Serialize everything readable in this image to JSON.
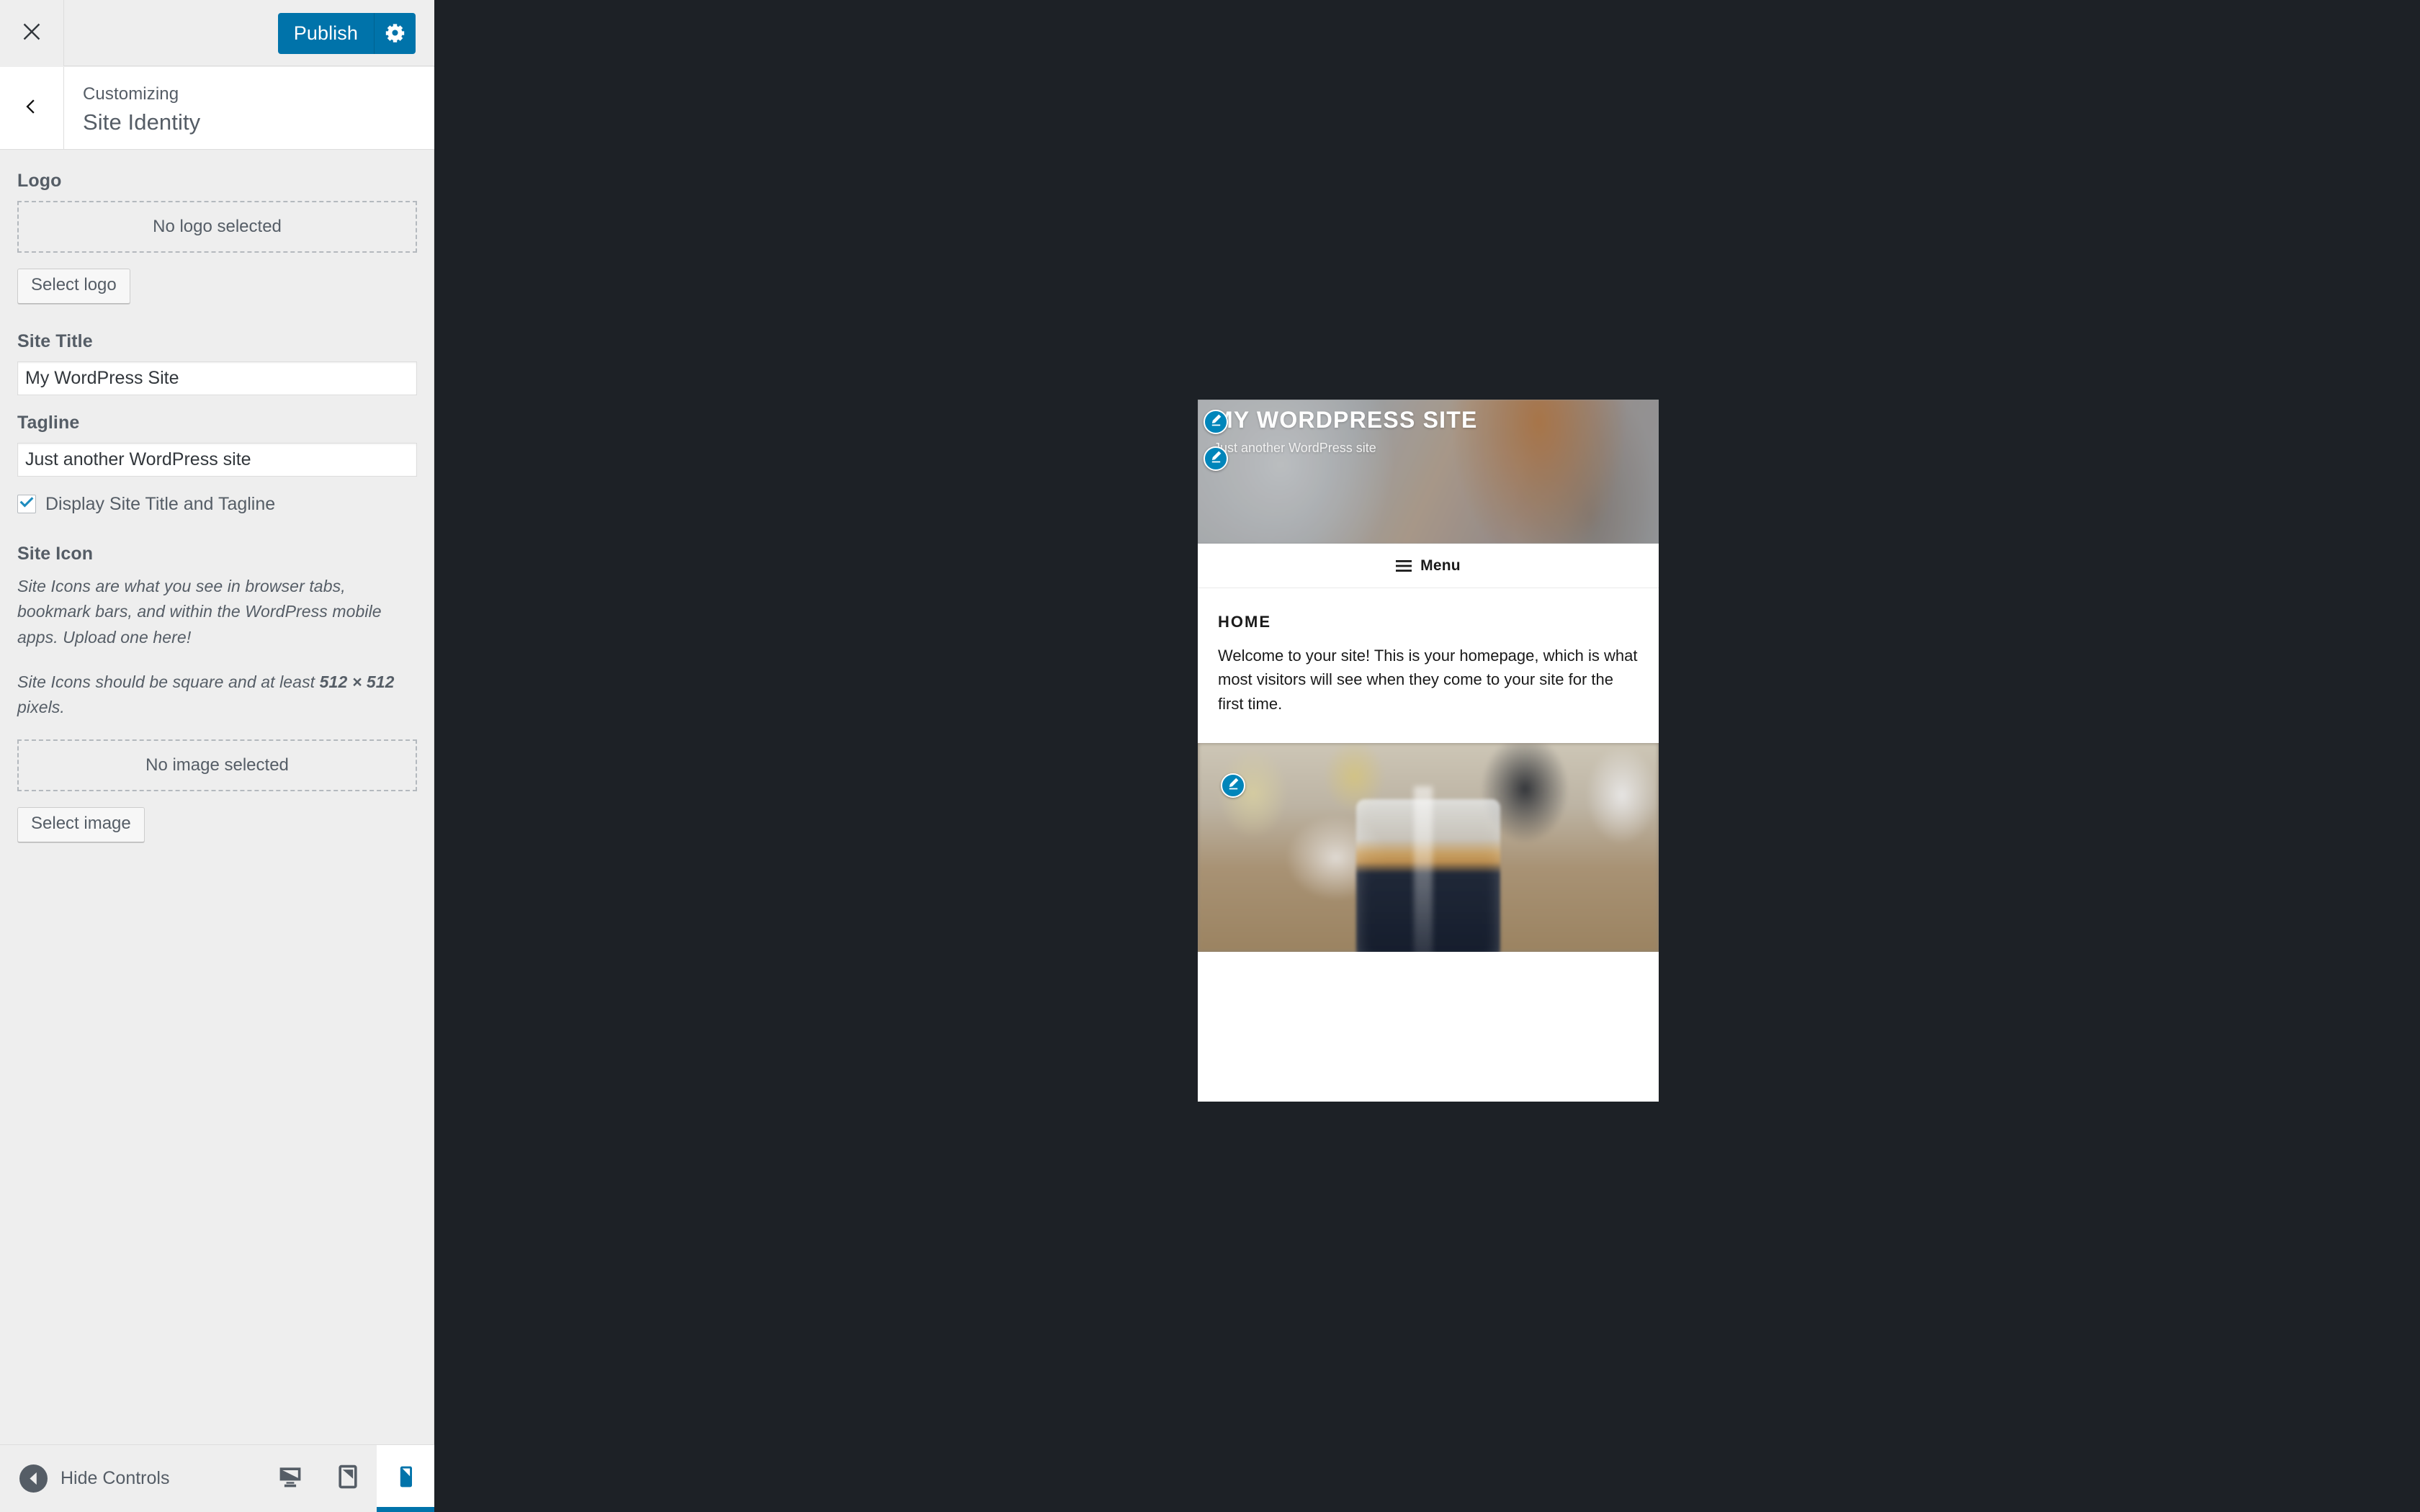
{
  "sidebar": {
    "header": {
      "close_icon": "close-icon",
      "publish_label": "Publish",
      "gear_icon": "gear-icon"
    },
    "panel": {
      "back_icon": "chevron-left-icon",
      "eyebrow": "Customizing",
      "title": "Site Identity"
    },
    "controls": {
      "logo": {
        "label": "Logo",
        "placeholder": "No logo selected",
        "button": "Select logo"
      },
      "site_title": {
        "label": "Site Title",
        "value": "My WordPress Site"
      },
      "tagline": {
        "label": "Tagline",
        "value": "Just another WordPress site"
      },
      "display_toggle": {
        "label": "Display Site Title and Tagline",
        "checked": true,
        "check_icon": "check-icon"
      },
      "site_icon": {
        "label": "Site Icon",
        "help_1": "Site Icons are what you see in browser tabs, bookmark bars, and within the WordPress mobile apps. Upload one here!",
        "help_2_before": "Site Icons should be square and at least ",
        "help_2_strong": "512 × 512",
        "help_2_after": " pixels.",
        "placeholder": "No image selected",
        "button": "Select image"
      }
    },
    "footer": {
      "collapse_icon": "collapse-arrow-icon",
      "collapse_label": "Hide Controls",
      "devices": [
        {
          "name": "desktop",
          "icon": "desktop-icon",
          "active": false
        },
        {
          "name": "tablet",
          "icon": "tablet-icon",
          "active": false
        },
        {
          "name": "mobile",
          "icon": "mobile-icon",
          "active": true
        }
      ]
    }
  },
  "preview": {
    "device": "mobile",
    "site": {
      "title": "MY WORDPRESS SITE",
      "tagline": "Just another WordPress site",
      "menu_label": "Menu",
      "menu_icon": "hamburger-icon",
      "entry_title": "HOME",
      "entry_body": "Welcome to your site! This is your homepage, which is what most visitors will see when they come to your site for the first time.",
      "edit_icon": "pencil-icon"
    }
  },
  "colors": {
    "wp_blue": "#0073aa",
    "edit_pencil_blue": "#0085ba",
    "sidebar_bg": "#eeeeee",
    "preview_bg": "#1d2126",
    "text_gray": "#555d66"
  }
}
